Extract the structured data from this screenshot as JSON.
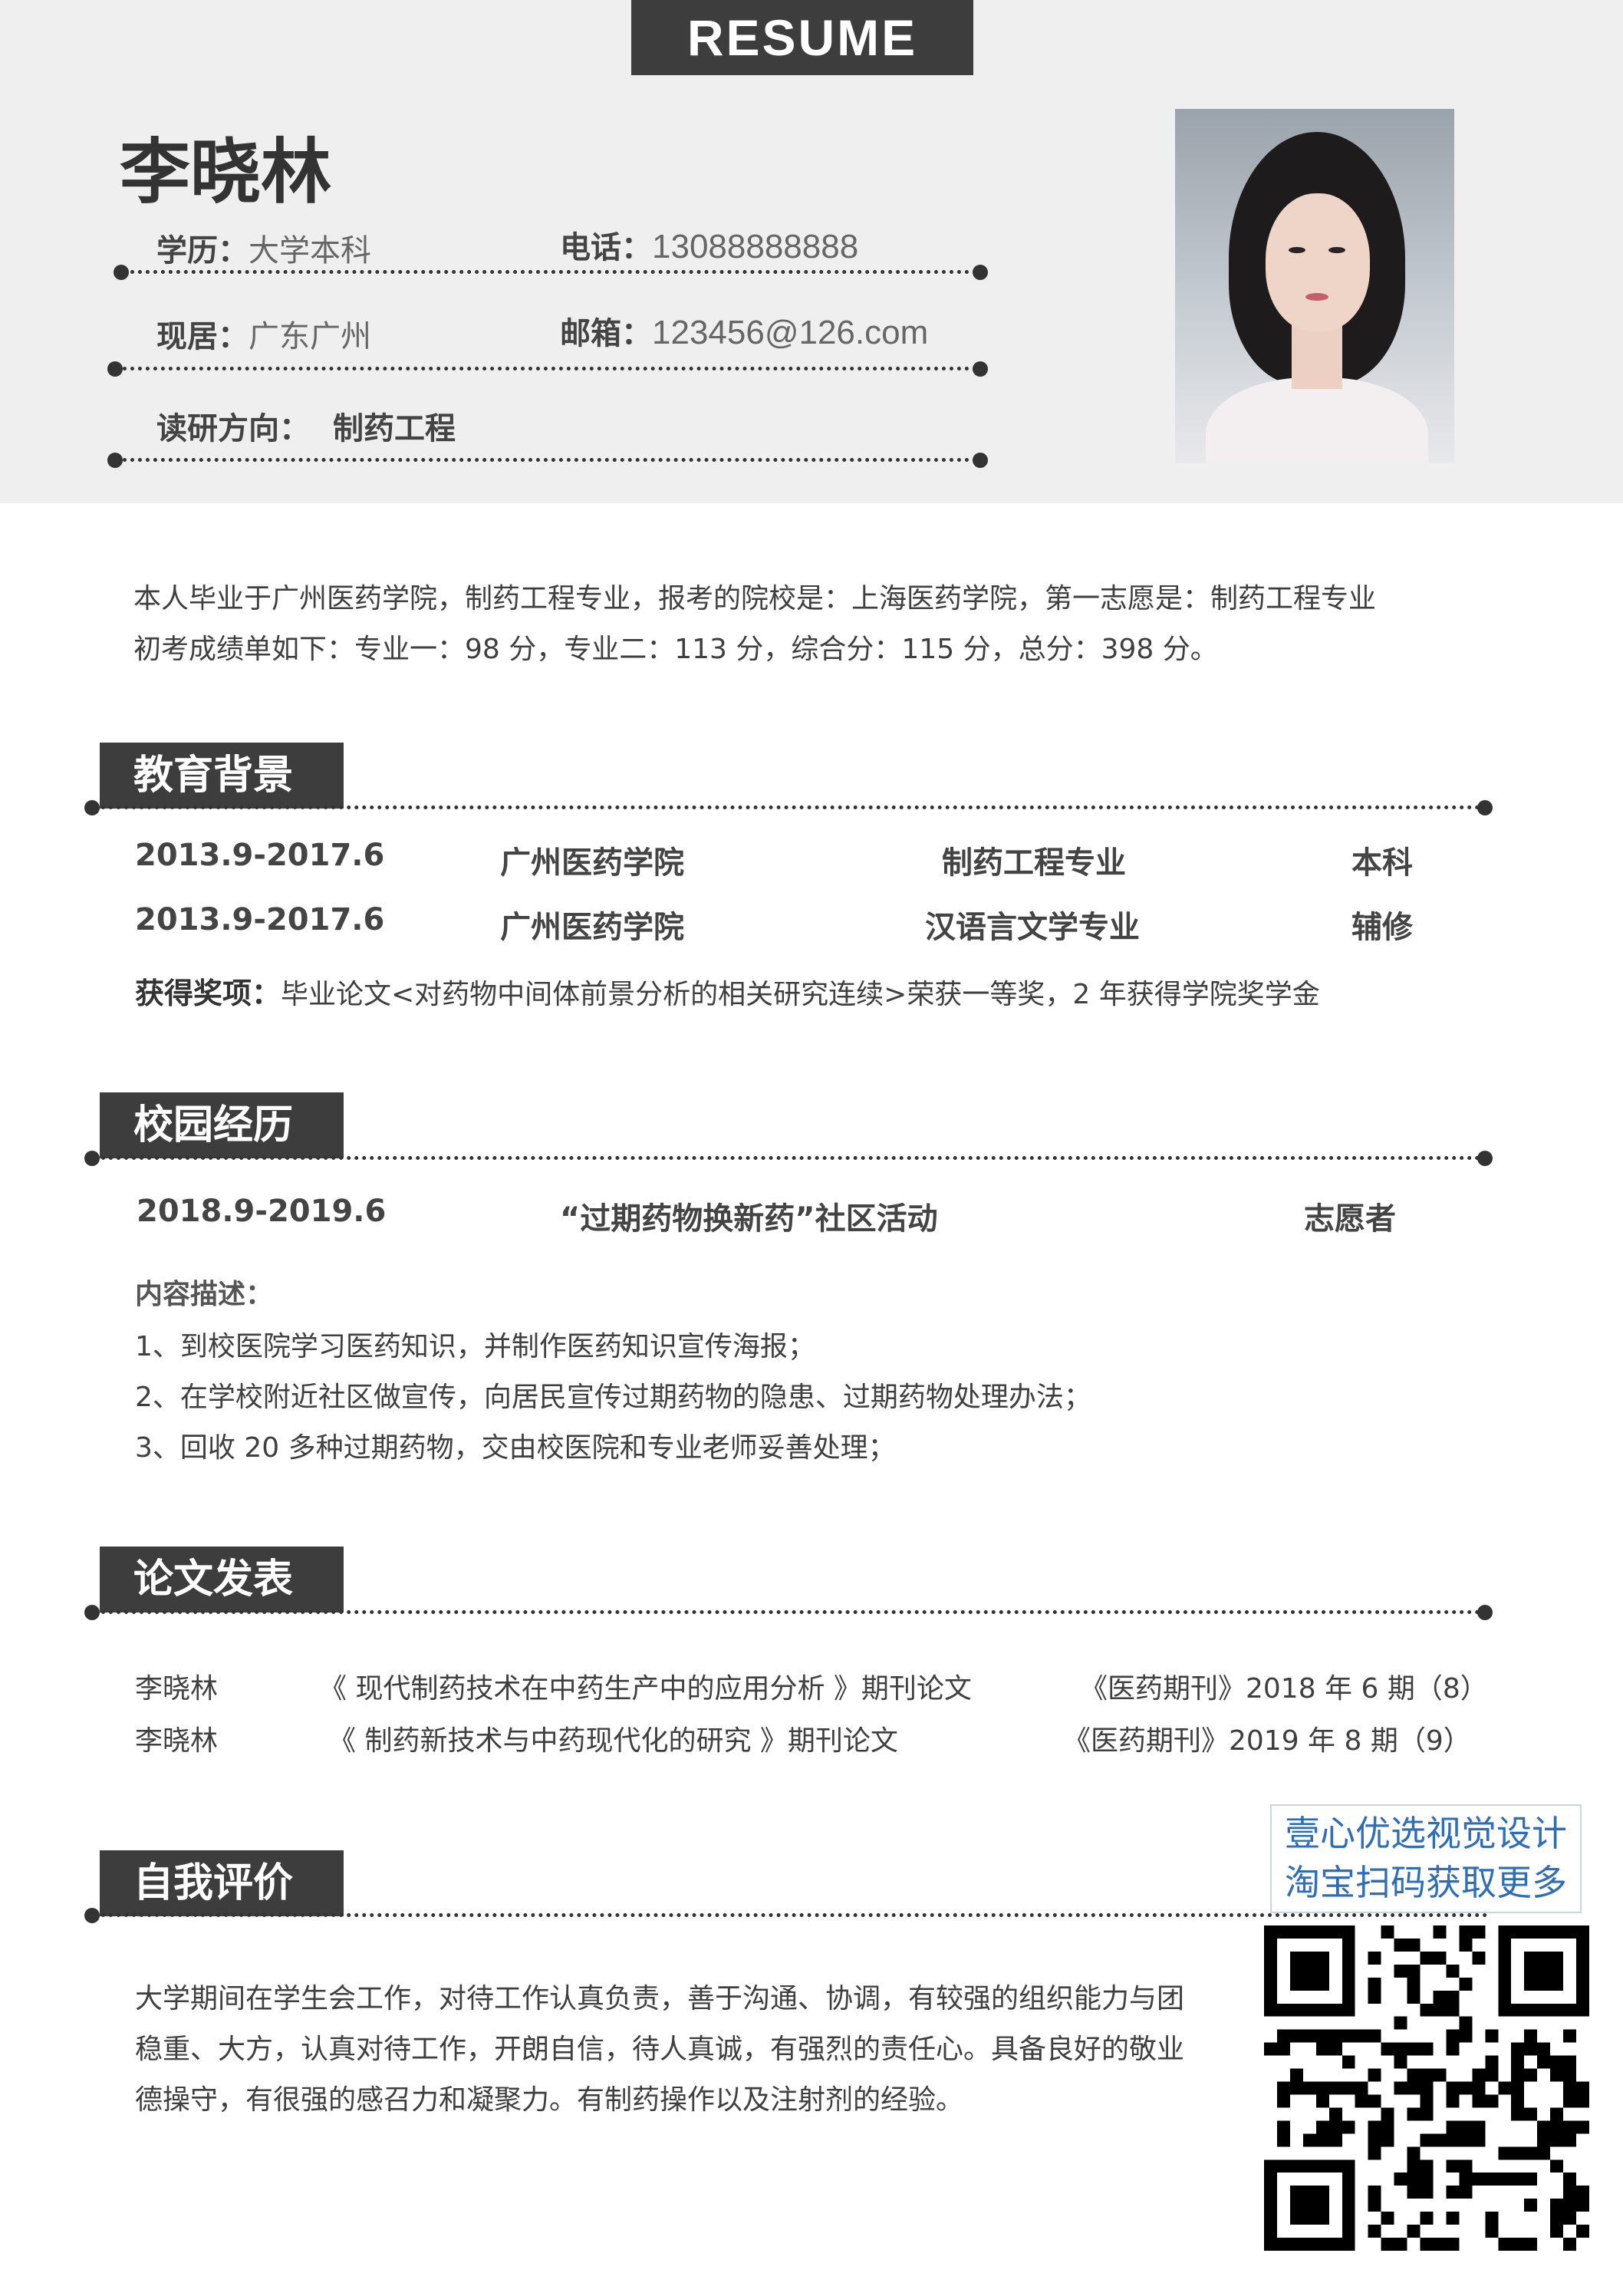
{
  "header": {
    "tag": "RESUME",
    "name": "李晓林",
    "education_label": "学历：",
    "education_value": "大学本科",
    "phone_label": "电话：",
    "phone_value": "13088888888",
    "residence_label": "现居：",
    "residence_value": "广东广州",
    "email_label": "邮箱：",
    "email_value": "123456@126.com",
    "research_label": "读研方向：",
    "research_value": "制药工程"
  },
  "intro": {
    "line1": "本人毕业于广州医药学院，制药工程专业，报考的院校是：上海医药学院，第一志愿是：制药工程专业",
    "line2": "初考成绩单如下：专业一：98 分，专业二：113 分，综合分：115 分，总分：398 分。"
  },
  "education": {
    "title": "教育背景",
    "rows": [
      {
        "date": "2013.9-2017.6",
        "school": "广州医药学院",
        "major": "制药工程专业",
        "degree": "本科"
      },
      {
        "date": "2013.9-2017.6",
        "school": "广州医药学院",
        "major": "汉语言文学专业",
        "degree": "辅修"
      }
    ],
    "awards_label": "获得奖项：",
    "awards_text": "毕业论文<对药物中间体前景分析的相关研究连续>荣获一等奖，2 年获得学院奖学金"
  },
  "campus": {
    "title": "校园经历",
    "date": "2018.9-2019.6",
    "activity": "“过期药物换新药”社区活动",
    "role": "志愿者",
    "desc_label": "内容描述：",
    "items": [
      "1、到校医院学习医药知识，并制作医药知识宣传海报；",
      "2、在学校附近社区做宣传，向居民宣传过期药物的隐患、过期药物处理办法；",
      "3、回收 20 多种过期药物，交由校医院和专业老师妥善处理；"
    ]
  },
  "papers": {
    "title": "论文发表",
    "rows": [
      {
        "author": "李晓林",
        "title": "《 现代制药技术在中药生产中的应用分析 》期刊论文",
        "journal": "《医药期刊》2018 年 6 期（8）"
      },
      {
        "author": "李晓林",
        "title": "《 制药新技术与中药现代化的研究 》期刊论文",
        "journal": "《医药期刊》2019 年 8 期（9）"
      }
    ]
  },
  "self_eval": {
    "title": "自我评价",
    "line1": "大学期间在学生会工作，对待工作认真负责，善于沟通、协调，有较强的组织能力与团",
    "line2": "稳重、大方，认真对待工作，开朗自信，待人真诚，有强烈的责任心。具备良好的敬业",
    "line3": "德操守，有很强的感召力和凝聚力。有制药操作以及注射剂的经验。"
  },
  "watermark": {
    "line1": "壹心优选视觉设计",
    "line2": "淘宝扫码获取更多"
  },
  "colors": {
    "header_bg": "#efefef",
    "title_bg": "#3d3d3d",
    "text": "#3f3f3f",
    "watermark_text": "#2f6db5"
  },
  "icons": [
    "portrait-photo",
    "qr-code"
  ]
}
